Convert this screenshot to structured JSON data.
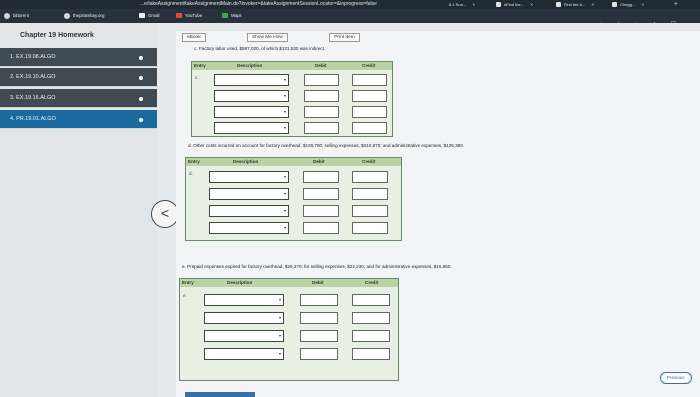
{
  "browser": {
    "url_text": "...e/takeAssignment/takeAssignmentMain.do?invoker=&takeAssignmentSessionLocator=&inprogress=false",
    "tabs": [
      {
        "label": "8.1 Sun...",
        "close": "✕"
      },
      {
        "label": "#Find the...",
        "close": "✕"
      },
      {
        "label": "Find the #...",
        "close": "✕"
      },
      {
        "label": "Chegg...",
        "close": "✕"
      }
    ],
    "new_tab": "+",
    "bookmarks": [
      "bittorent",
      "thepiratebay.org",
      "Gmail",
      "YouTube",
      "Maps"
    ],
    "toolbar_icons": "⌂ ☆ ♦ ★ ☐"
  },
  "sidebar": {
    "title": "Chapter 19 Homework",
    "items": [
      {
        "label": "1. EX.19.08.ALGO"
      },
      {
        "label": "2. EX.19.10.ALGO"
      },
      {
        "label": "3. EX.19.16.ALGO"
      },
      {
        "label": "4. PR.19.01.ALGO"
      }
    ]
  },
  "nav": {
    "ebook": "eBook",
    "show_me_how": "Show Me How",
    "print_item": "Print Item"
  },
  "questions": {
    "c": "c.  Factory labor used, $587,020, of which $131,530 was indirect.",
    "d": "d.  Other costs incurred on account for factory overhead, $136,780; selling expenses, $210,870; and administrative expenses, $125,380.",
    "e": "e.  Prepaid expenses expired for factory overhead, $26,2?0; for selling expenses, $22,230; and for administrative expenses, $15,960."
  },
  "table": {
    "headers": {
      "entry": "Entry",
      "description": "Description",
      "debit": "Debit",
      "credit": "Credit"
    }
  },
  "entries": {
    "c": {
      "letter": "c."
    },
    "d": {
      "letter": "d."
    },
    "e": {
      "letter": "e."
    }
  },
  "back_chevron": "<",
  "previous_button": "Previous"
}
